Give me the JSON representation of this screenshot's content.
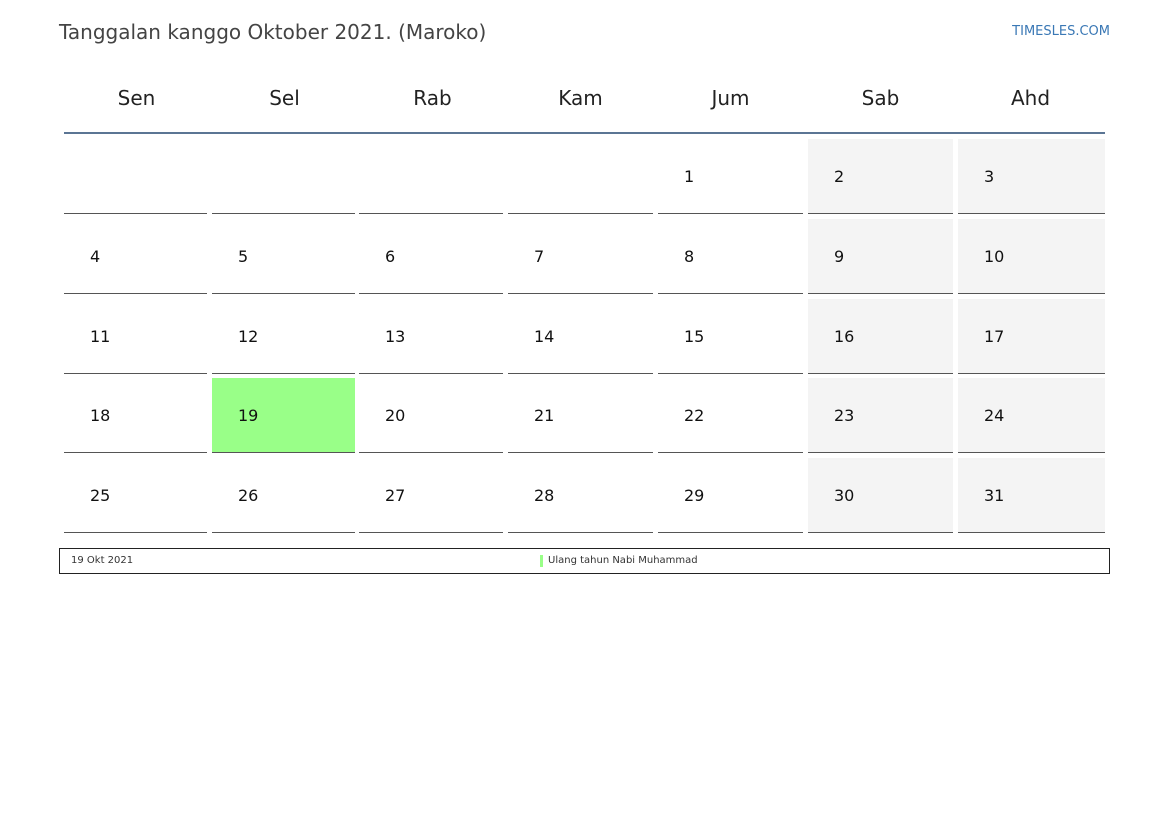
{
  "header": {
    "title": "Tanggalan kanggo Oktober 2021. (Maroko)",
    "site": "TIMESLES.COM"
  },
  "calendar": {
    "weekdays": [
      "Sen",
      "Sel",
      "Rab",
      "Kam",
      "Jum",
      "Sab",
      "Ahd"
    ],
    "first_weekday_index": 4,
    "days_in_month": 31,
    "weekend_columns": [
      5,
      6
    ],
    "highlighted_days": [
      19
    ],
    "colors": {
      "weekend_bg": "#f4f4f4",
      "holiday_bg": "#99ff88",
      "header_rule": "#5b7594"
    }
  },
  "legend": {
    "date": "19 Okt 2021",
    "holiday": "Ulang tahun Nabi Muhammad"
  }
}
